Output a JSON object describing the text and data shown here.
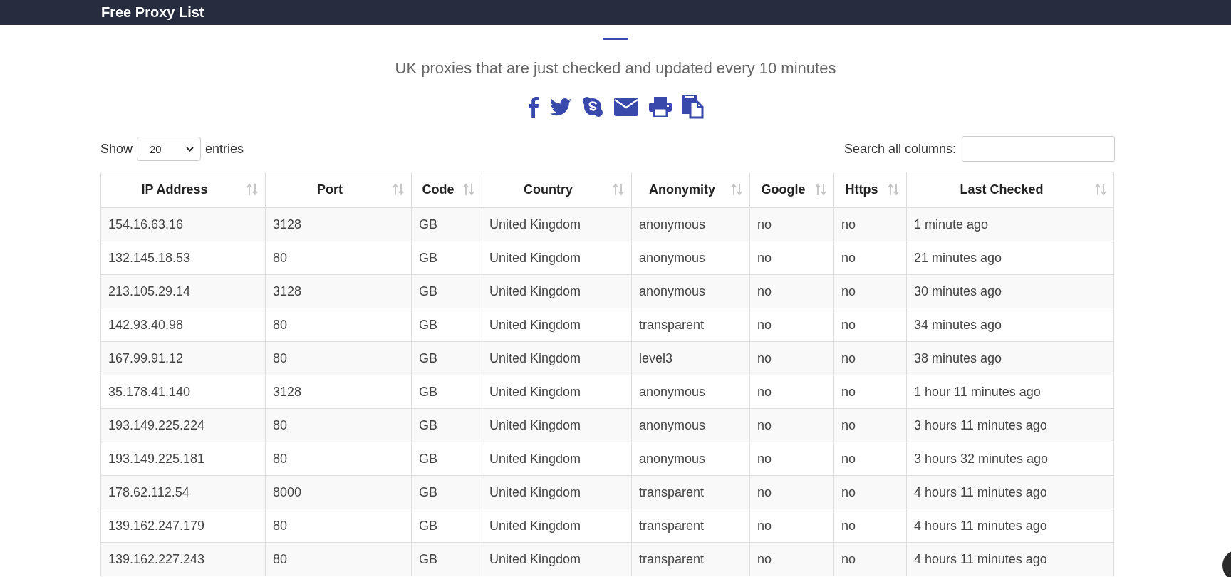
{
  "header": {
    "logo": "Free Proxy List"
  },
  "subtitle": "UK proxies that are just checked and updated every 10 minutes",
  "length_control": {
    "label": "Show",
    "value": "20",
    "suffix": "entries"
  },
  "search": {
    "label": "Search all columns:"
  },
  "table": {
    "columns": [
      "IP Address",
      "Port",
      "Code",
      "Country",
      "Anonymity",
      "Google",
      "Https",
      "Last Checked"
    ],
    "rows": [
      [
        "154.16.63.16",
        "3128",
        "GB",
        "United Kingdom",
        "anonymous",
        "no",
        "no",
        "1 minute ago"
      ],
      [
        "132.145.18.53",
        "80",
        "GB",
        "United Kingdom",
        "anonymous",
        "no",
        "no",
        "21 minutes ago"
      ],
      [
        "213.105.29.14",
        "3128",
        "GB",
        "United Kingdom",
        "anonymous",
        "no",
        "no",
        "30 minutes ago"
      ],
      [
        "142.93.40.98",
        "80",
        "GB",
        "United Kingdom",
        "transparent",
        "no",
        "no",
        "34 minutes ago"
      ],
      [
        "167.99.91.12",
        "80",
        "GB",
        "United Kingdom",
        "level3",
        "no",
        "no",
        "38 minutes ago"
      ],
      [
        "35.178.41.140",
        "3128",
        "GB",
        "United Kingdom",
        "anonymous",
        "no",
        "no",
        "1 hour 11 minutes ago"
      ],
      [
        "193.149.225.224",
        "80",
        "GB",
        "United Kingdom",
        "anonymous",
        "no",
        "no",
        "3 hours 11 minutes ago"
      ],
      [
        "193.149.225.181",
        "80",
        "GB",
        "United Kingdom",
        "anonymous",
        "no",
        "no",
        "3 hours 32 minutes ago"
      ],
      [
        "178.62.112.54",
        "8000",
        "GB",
        "United Kingdom",
        "transparent",
        "no",
        "no",
        "4 hours 11 minutes ago"
      ],
      [
        "139.162.247.179",
        "80",
        "GB",
        "United Kingdom",
        "transparent",
        "no",
        "no",
        "4 hours 11 minutes ago"
      ],
      [
        "139.162.227.243",
        "80",
        "GB",
        "United Kingdom",
        "transparent",
        "no",
        "no",
        "4 hours 11 minutes ago"
      ]
    ]
  }
}
